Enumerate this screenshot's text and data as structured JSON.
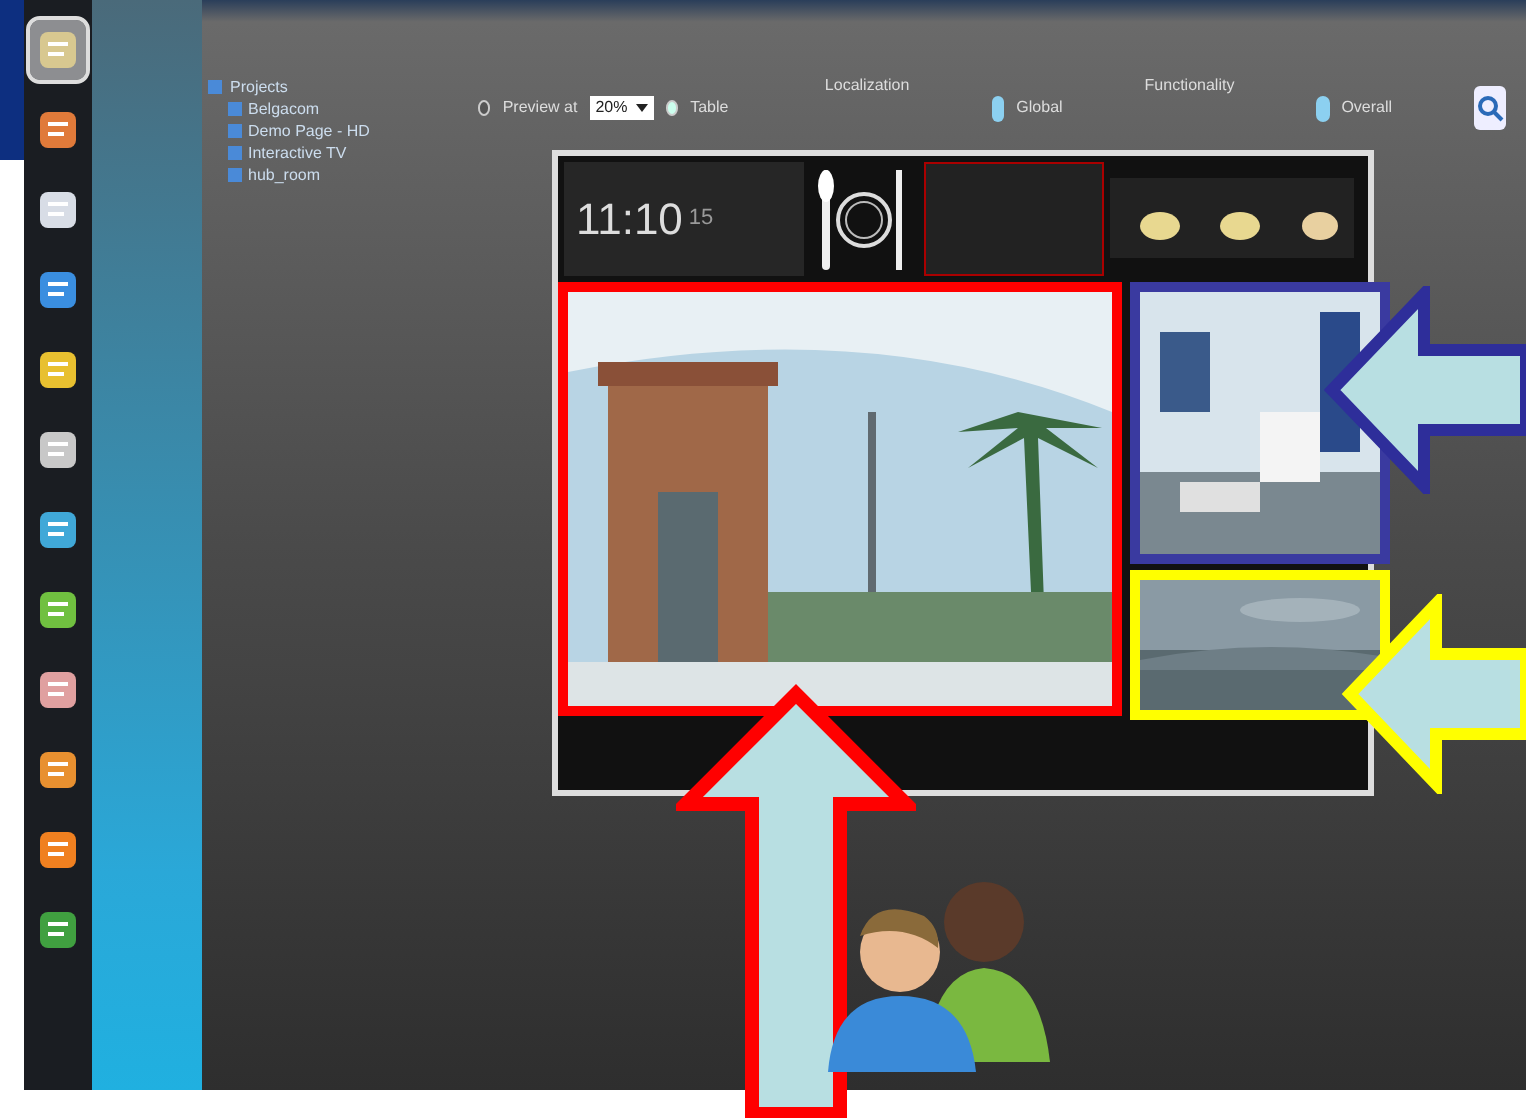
{
  "dock": [
    {
      "color": "#d8c890",
      "selected": true
    },
    {
      "color": "#e07a3a",
      "selected": false
    },
    {
      "color": "#d8dde6",
      "selected": false
    },
    {
      "color": "#3a8ee0",
      "selected": false
    },
    {
      "color": "#e8c030",
      "selected": false
    },
    {
      "color": "#c8c8c8",
      "selected": false
    },
    {
      "color": "#40a8d8",
      "selected": false
    },
    {
      "color": "#70c040",
      "selected": false
    },
    {
      "color": "#e0a0a0",
      "selected": false
    },
    {
      "color": "#e89030",
      "selected": false
    },
    {
      "color": "#f08020",
      "selected": false
    },
    {
      "color": "#40a040",
      "selected": false
    }
  ],
  "tree": {
    "label": "Projects",
    "children": [
      {
        "label": "Belgacom"
      },
      {
        "label": "Demo Page - HD"
      },
      {
        "label": "Interactive TV"
      },
      {
        "label": "hub_room"
      }
    ]
  },
  "view": {
    "options": [
      {
        "label": "Preview at",
        "selected": false
      },
      {
        "label": "Table",
        "selected": true
      }
    ],
    "zoom": "20%"
  },
  "filters": [
    {
      "label": "Localization",
      "value": "Global"
    },
    {
      "label": "Functionality",
      "value": "Overall"
    }
  ],
  "preview": {
    "clock": "11:10",
    "seconds": "15"
  },
  "highlights": [
    {
      "color": "#ff0000"
    },
    {
      "color": "#3a3aa0"
    },
    {
      "color": "#ffff00"
    }
  ]
}
